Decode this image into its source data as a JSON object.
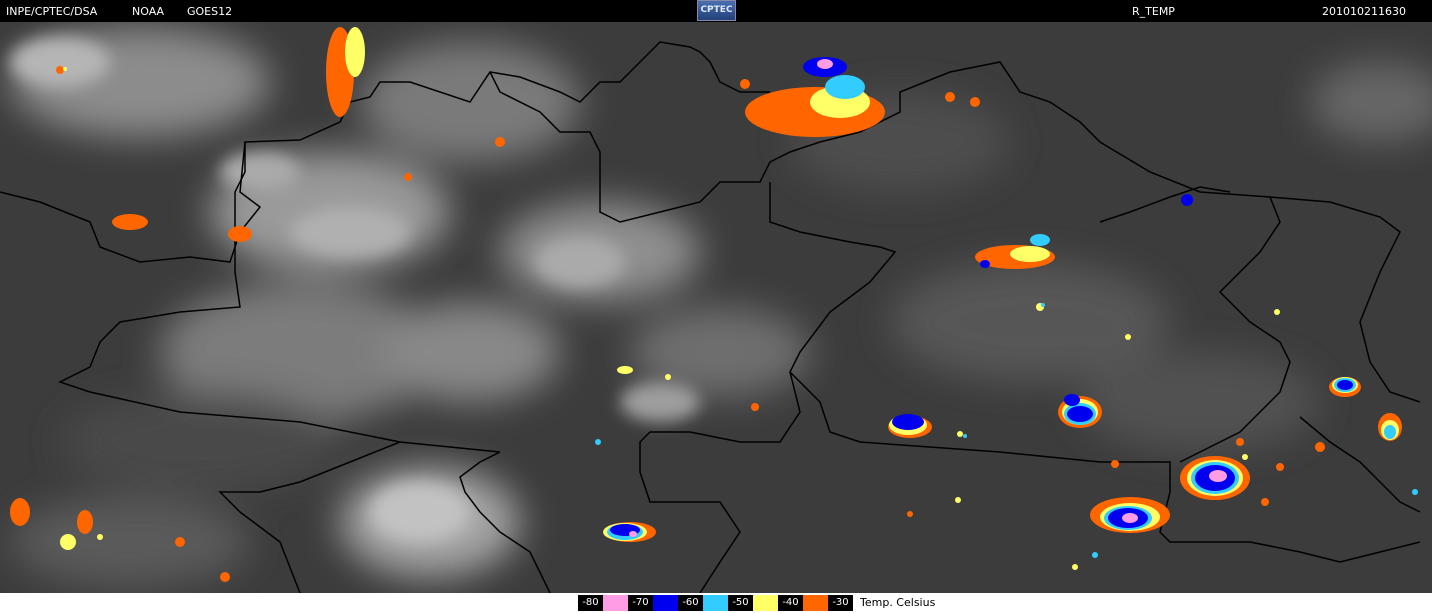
{
  "header": {
    "source": "INPE/CPTEC/DSA",
    "agency": "NOAA",
    "satellite": "GOES12",
    "logo_text": "CPTEC",
    "product": "R_TEMP",
    "timestamp": "201010211630"
  },
  "legend": {
    "unit_label": "Temp. Celsius",
    "bins": [
      {
        "value": "-80",
        "color": "#000000",
        "text_color": "#ffffff"
      },
      {
        "value": "",
        "color": "#ff9ce6",
        "text_color": "#000000"
      },
      {
        "value": "-70",
        "color": "#000000",
        "text_color": "#ffffff"
      },
      {
        "value": "",
        "color": "#0000ee",
        "text_color": "#ffffff"
      },
      {
        "value": "-60",
        "color": "#000000",
        "text_color": "#ffffff"
      },
      {
        "value": "",
        "color": "#33ccff",
        "text_color": "#000000"
      },
      {
        "value": "-50",
        "color": "#000000",
        "text_color": "#ffffff"
      },
      {
        "value": "",
        "color": "#ffff66",
        "text_color": "#000000"
      },
      {
        "value": "-40",
        "color": "#000000",
        "text_color": "#ffffff"
      },
      {
        "value": "",
        "color": "#ff6600",
        "text_color": "#000000"
      },
      {
        "value": "-30",
        "color": "#000000",
        "text_color": "#ffffff"
      }
    ]
  }
}
